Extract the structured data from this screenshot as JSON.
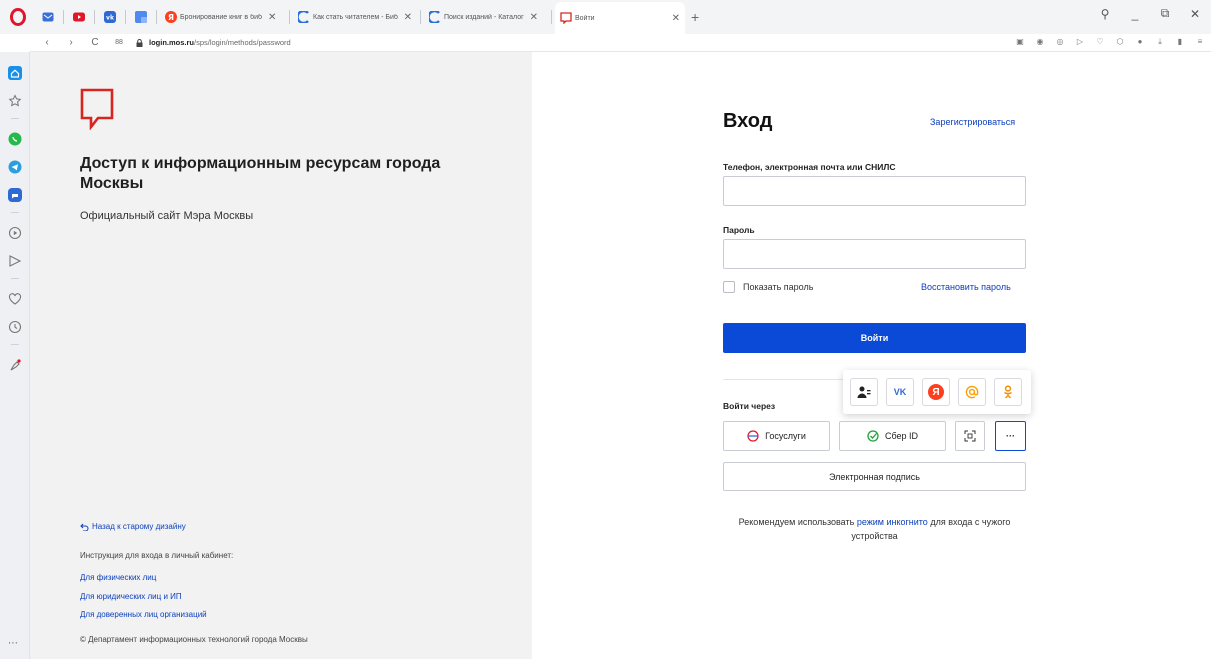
{
  "browser": {
    "tabs": [
      {
        "title": "Бронирование книг в биб"
      },
      {
        "title": "Как стать читателем - Биб"
      },
      {
        "title": "Поиск изданий - Каталог"
      },
      {
        "title": "Войти"
      }
    ],
    "new_tab_label": "+",
    "url_host": "login.mos.ru",
    "url_path": "/sps/login/methods/password",
    "back_symbol": "‹",
    "forward_symbol": "›",
    "reload_symbol": "C",
    "tabs_symbol": "88",
    "close_symbol": "✕",
    "minimize_symbol": "_",
    "more_symbol": "⋯"
  },
  "colors": {
    "accent": "#0a4ad6",
    "link": "#0b3fba",
    "logo_red": "#d7261f"
  },
  "left": {
    "title": "Доступ к информационным ресурсам города Москвы",
    "subtitle": "Официальный сайт Мэра Москвы",
    "back_link": "Назад к старому дизайну",
    "instructions_label": "Инструкция для входа в личный кабинет:",
    "links": [
      "Для физических лиц",
      "Для юридических лиц и ИП",
      "Для доверенных лиц организаций"
    ],
    "copyright": "© Департамент информационных технологий города Москвы"
  },
  "form": {
    "title": "Вход",
    "register": "Зарегистрироваться",
    "login_label": "Телефон, электронная почта или СНИЛС",
    "login_value": "",
    "password_label": "Пароль",
    "password_value": "",
    "show_password": "Показать пароль",
    "restore_password": "Восстановить пароль",
    "submit": "Войти",
    "login_via": "Войти через",
    "gosuslugi": "Госуслуги",
    "sber": "Сбер ID",
    "qr_icon": "qr-scan-icon",
    "more": "···",
    "e_signature": "Электронная подпись",
    "recommend_prefix": "Рекомендуем использовать ",
    "recommend_link": "режим инкогнито",
    "recommend_suffix": " для входа с чужого устройства"
  },
  "popup": {
    "providers": [
      "user-id-icon",
      "vk-icon",
      "yandex-icon",
      "mailru-icon",
      "odnoklassniki-icon"
    ],
    "vk_text": "VK",
    "yandex_text": "Я"
  }
}
